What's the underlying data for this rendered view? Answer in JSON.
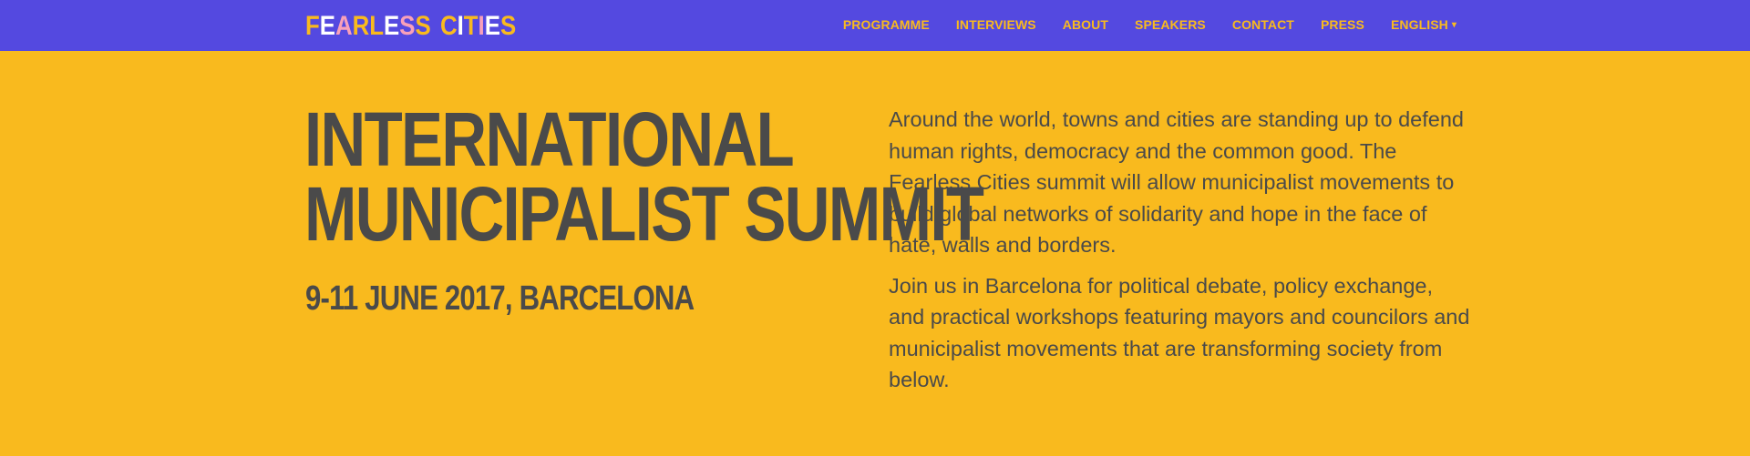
{
  "brand": {
    "letters": [
      {
        "char": "F",
        "color": "#f9ba1e"
      },
      {
        "char": "E",
        "color": "#ffffff"
      },
      {
        "char": "A",
        "color": "#f8a0b9"
      },
      {
        "char": "R",
        "color": "#f9ba1e"
      },
      {
        "char": "L",
        "color": "#f9ba1e"
      },
      {
        "char": "E",
        "color": "#ffffff"
      },
      {
        "char": "S",
        "color": "#f8a0b9"
      },
      {
        "char": "S",
        "color": "#f9ba1e"
      },
      {
        "char": " ",
        "color": "#ffffff"
      },
      {
        "char": "C",
        "color": "#f9ba1e"
      },
      {
        "char": "I",
        "color": "#ffffff"
      },
      {
        "char": "T",
        "color": "#f9ba1e"
      },
      {
        "char": "I",
        "color": "#f8a0b9"
      },
      {
        "char": "E",
        "color": "#ffffff"
      },
      {
        "char": "S",
        "color": "#f9ba1e"
      }
    ]
  },
  "nav": {
    "items": [
      {
        "label": "PROGRAMME",
        "name": "nav-programme"
      },
      {
        "label": "INTERVIEWS",
        "name": "nav-interviews"
      },
      {
        "label": "ABOUT",
        "name": "nav-about"
      },
      {
        "label": "SPEAKERS",
        "name": "nav-speakers"
      },
      {
        "label": "CONTACT",
        "name": "nav-contact"
      },
      {
        "label": "PRESS",
        "name": "nav-press"
      }
    ],
    "language": {
      "label": "ENGLISH",
      "icon": "caret-down-icon",
      "caret": "▾"
    }
  },
  "hero": {
    "headline_line1": "INTERNATIONAL",
    "headline_line2": "MUNICIPALIST SUMMIT",
    "dates": "9-11 JUNE 2017, BARCELONA",
    "paragraph1": "Around the world, towns and cities are standing up to defend human rights, democracy and the common good. The Fearless Cities summit will allow municipalist movements to build global networks of solidarity and hope in the face of hate, walls and borders.",
    "paragraph2": "Join us in Barcelona for political debate, policy exchange, and practical workshops featuring mayors and councilors and municipalist movements that are transforming society from below."
  },
  "colors": {
    "nav_background": "#5449e0",
    "page_background": "#f9ba1e",
    "nav_link": "#f9ba1e",
    "text": "#4a4a4a",
    "accent_pink": "#f8a0b9"
  }
}
